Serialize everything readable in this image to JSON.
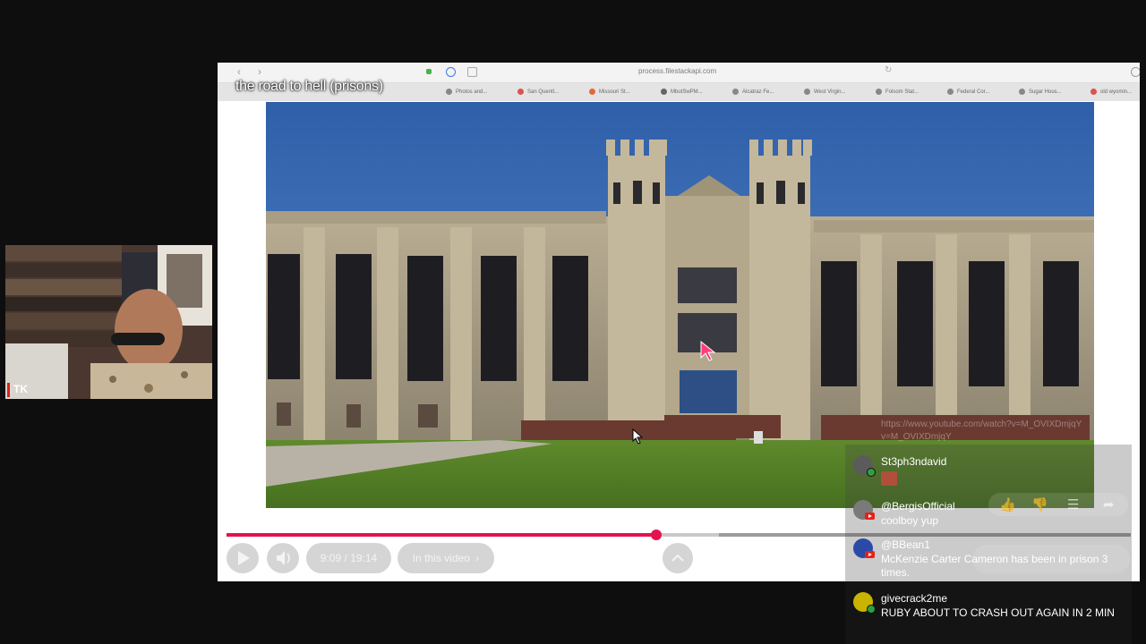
{
  "browser": {
    "url": "process.filestackapi.com",
    "back": "‹",
    "forward": "›",
    "reload": "↻",
    "tabs": [
      {
        "label": "the road to hell (prisons) –",
        "color": "#d9534f"
      },
      {
        "label": "Photos and...",
        "color": "#888888"
      },
      {
        "label": "San Quentl...",
        "color": "#d9534f"
      },
      {
        "label": "Missouri St...",
        "color": "#e06a3d"
      },
      {
        "label": "MbutSwPM...",
        "color": "#666666"
      },
      {
        "label": "Alcatraz Fe...",
        "color": "#888888"
      },
      {
        "label": "West Virgin...",
        "color": "#888888"
      },
      {
        "label": "Folsom Stat...",
        "color": "#888888"
      },
      {
        "label": "Federal Cor...",
        "color": "#888888"
      },
      {
        "label": "Sugar Hous...",
        "color": "#888888"
      },
      {
        "label": "old wyomin...",
        "color": "#d9534f"
      }
    ]
  },
  "video": {
    "title": "the road to hell (prisons)",
    "time": "9:09 / 19:14",
    "chapter": "In this video",
    "chapter_arrow": "›",
    "progress_fraction": 0.475,
    "buffered_fraction": 0.545,
    "accent": "#e4134f"
  },
  "webcam": {
    "label": "TK"
  },
  "chat": {
    "faded_link": "https://www.youtube.com/watch?v=M_OVIXDmjqY",
    "faded_link_line2": "v=M_OVIXDmjqY",
    "messages": [
      {
        "user": "St3ph3ndavid",
        "text": "",
        "emoji": "sticker",
        "avatar_color": "#5b5b5b",
        "badge": "member"
      },
      {
        "user": "@BergisOfficial",
        "text": "coolboy yup",
        "avatar_color": "#7a7a7a",
        "badge": "youtube"
      },
      {
        "user": "@BBean1",
        "text": "McKenzie Carter Cameron has been in prison 3 times.",
        "avatar_color": "#2b4aa8",
        "badge": "youtube"
      },
      {
        "user": "givecrack2me",
        "text": "RUBY ABOUT TO CRASH OUT AGAIN IN 2 MIN",
        "avatar_color": "#c9b400",
        "badge": "member"
      }
    ]
  }
}
